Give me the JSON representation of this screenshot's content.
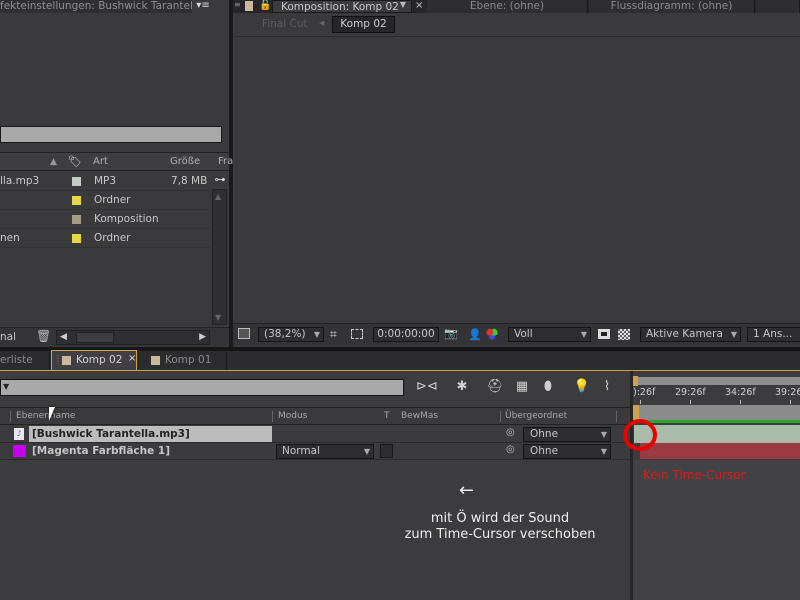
{
  "effect_panel": {
    "title": "fekteinstellungen: Bushwick Tarantella",
    "menu_icon": "panel-menu-icon"
  },
  "project_panel": {
    "columns": {
      "sort_arrow": "▲",
      "label_icon": "tag-icon",
      "type": "Art",
      "size": "Größe",
      "frame": "Fra"
    },
    "rows": [
      {
        "name": "lla.mp3",
        "label_color": "#c7cbc5",
        "type": "MP3",
        "size": "7,8 MB"
      },
      {
        "name": "",
        "label_color": "#e3d94a",
        "type": "Ordner",
        "size": ""
      },
      {
        "name": "",
        "label_color": "#a59e83",
        "type": "Komposition",
        "size": ""
      },
      {
        "name": "nen",
        "label_color": "#e3d94a",
        "type": "Ordner",
        "size": ""
      }
    ],
    "footer": {
      "bpc": "nal",
      "trash_icon": "trash-icon"
    }
  },
  "comp_panel": {
    "tabs": [
      {
        "label": "Komposition: Komp 02",
        "active": true
      },
      {
        "label": "Ebene: (ohne)"
      },
      {
        "label": "Flussdiagramm: (ohne)"
      }
    ],
    "breadcrumb": {
      "prev": "Final Cut",
      "current": "Komp 02"
    },
    "toolbar": {
      "zoom": "(38,2%)",
      "timecode": "0:00:00:00",
      "resolution": "Voll",
      "camera": "Aktive Kamera",
      "views": "1 Ans..."
    }
  },
  "timeline_tabs": [
    {
      "label": "erliste"
    },
    {
      "label": "Komp 02",
      "active": true,
      "close": "×"
    },
    {
      "label": "Komp 01"
    }
  ],
  "timeline": {
    "columns": {
      "name": "Ebenenname",
      "mode": "Modus",
      "t": "T",
      "trkmat": "BewMas",
      "parent": "Übergeordnet"
    },
    "layers": [
      {
        "name": "[Bushwick Tarantella.mp3]",
        "icon": "audio-file-icon",
        "mode": "",
        "parent": "Ohne",
        "selected": true
      },
      {
        "name": "[Magenta Farbfläche 1]",
        "color": "#c800f0",
        "mode": "Normal",
        "parent": "Ohne"
      }
    ],
    "ruler": [
      "):26f",
      "29:26f",
      "34:26f",
      "39:26"
    ]
  },
  "annotations": {
    "arrow": "←",
    "caption_line1": "mit Ö wird der Sound",
    "caption_line2": "zum Time-Cursor verschoben",
    "red_label": "Kein Time-Cursor"
  }
}
